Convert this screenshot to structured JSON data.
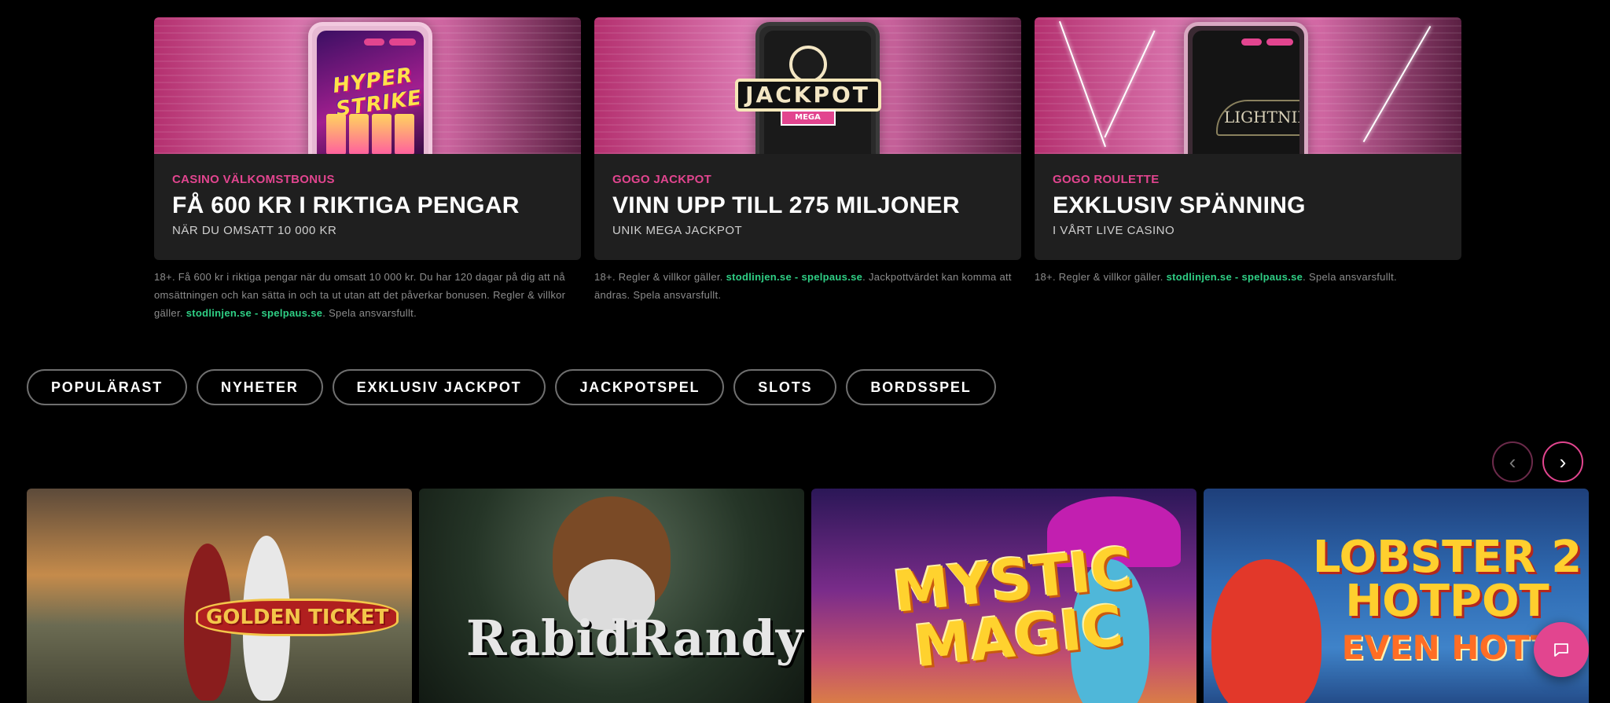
{
  "promos": [
    {
      "kicker": "CASINO VÄLKOMSTBONUS",
      "title": "FÅ 600 KR I RIKTIGA PENGAR",
      "subtitle": "NÄR DU OMSATT 10 000 KR",
      "terms_before": "18+. Få 600 kr i riktiga pengar när du omsatt 10 000 kr. Du har 120 dagar på dig att nå omsättningen och kan sätta in och ta ut utan att det påverkar bonusen. Regler & villkor gäller. ",
      "link1": "stodlinjen.se",
      "sep": " - ",
      "link2": "spelpaus.se",
      "terms_after": ". Spela ansvarsfullt.",
      "image_logo": "HYPER STRIKE"
    },
    {
      "kicker": "GOGO JACKPOT",
      "title": "VINN UPP TILL 275 MILJONER",
      "subtitle": "UNIK MEGA JACKPOT",
      "terms_before": "18+. Regler & villkor gäller. ",
      "link1": "stodlinjen.se",
      "sep": " - ",
      "link2": "spelpaus.se",
      "terms_after": ". Jackpottvärdet kan komma att ändras. Spela ansvarsfullt.",
      "image_logo": "JACKPOT",
      "image_logo_sub": "MEGA"
    },
    {
      "kicker": "GOGO ROULETTE",
      "title": "EXKLUSIV SPÄNNING",
      "subtitle": "I VÅRT LIVE CASINO",
      "terms_before": "18+. Regler & villkor gäller. ",
      "link1": "stodlinjen.se",
      "sep": " - ",
      "link2": "spelpaus.se",
      "terms_after": ". Spela ansvarsfullt.",
      "image_logo": "LIGHTNING"
    }
  ],
  "categories": [
    "POPULÄRAST",
    "NYHETER",
    "EXKLUSIV JACKPOT",
    "JACKPOTSPEL",
    "SLOTS",
    "BORDSSPEL"
  ],
  "carousel": {
    "prev_icon": "chevron-left-icon",
    "next_icon": "chevron-right-icon",
    "prev_glyph": "‹",
    "next_glyph": "›"
  },
  "games": [
    {
      "logo": "GOLDEN TICKET"
    },
    {
      "logo": "RabidRandy"
    },
    {
      "logo": "MYSTIC MAGIC"
    },
    {
      "logo": "LOBSTER 2 HOTPOT",
      "logo_sub": "EVEN HOTT"
    }
  ],
  "colors": {
    "accent": "#e2458f",
    "link": "#2fcf85",
    "card_bg": "#1f1f1f",
    "page_bg": "#000000"
  },
  "chat": {
    "icon": "chat-icon"
  }
}
